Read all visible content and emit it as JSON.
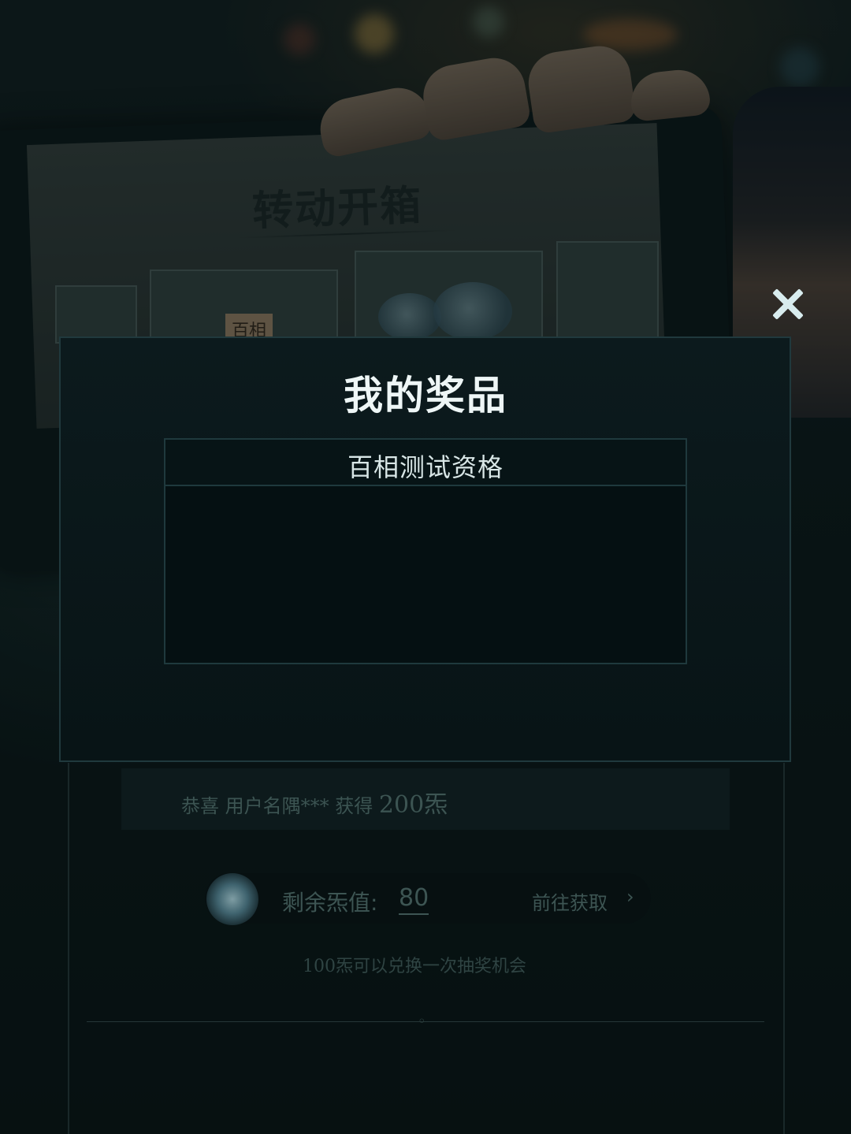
{
  "background": {
    "banner_title": "转动开箱",
    "ticket_label": "百相",
    "broadcast": {
      "prefix": "恭喜 用户名隅*** 获得",
      "amount": "200",
      "unit": "炁"
    },
    "points": {
      "label": "剩余炁值:",
      "value": "80",
      "get_more_label": "前往获取",
      "chevron": "›"
    },
    "exchange_note": "100炁可以兑换一次抽奖机会"
  },
  "modal": {
    "title": "我的奖品",
    "table_header": "百相测试资格",
    "close_icon": "close-icon"
  },
  "colors": {
    "modal_bg": "#081416",
    "modal_border": "#20393d",
    "title_text": "#eef6f6",
    "close_icon": "#d8ecee"
  }
}
